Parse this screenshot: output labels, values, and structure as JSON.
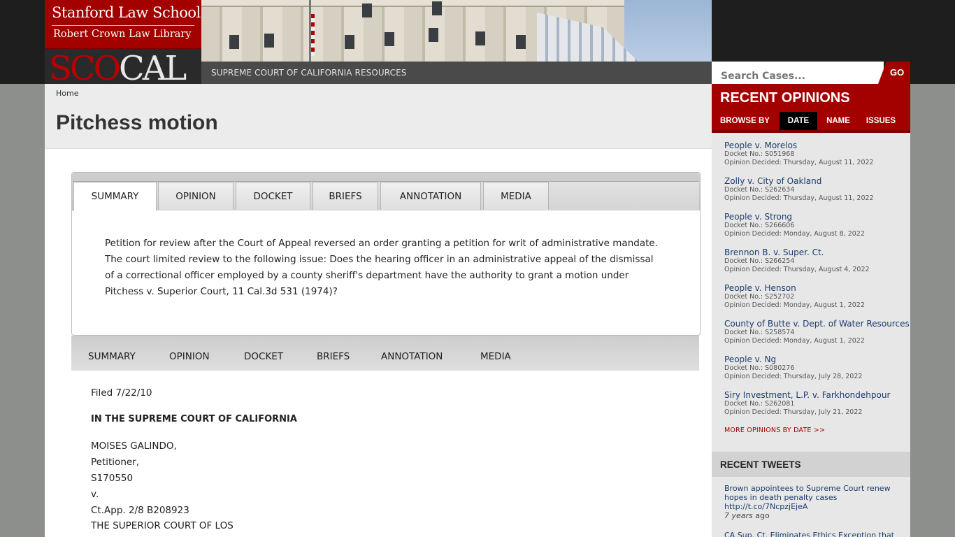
{
  "header": {
    "school": "Stanford Law School",
    "library": "Robert Crown Law Library",
    "logo_sco": "SCO",
    "logo_cal": "CAL",
    "tagline": "SUPREME COURT OF CALIFORNIA RESOURCES",
    "search_placeholder": "Search Cases...",
    "search_button": "GO"
  },
  "breadcrumb": "Home",
  "page_title": "Pitchess motion",
  "tabs": [
    "SUMMARY",
    "OPINION",
    "DOCKET",
    "BRIEFS",
    "ANNOTATION",
    "MEDIA"
  ],
  "active_tab": "SUMMARY",
  "summary_lines": [
    "Petition for review after the Court of Appeal reversed an order granting a petition for writ of administrative mandate.",
    "The court limited review to the following issue: Does the hearing officer in an administrative appeal of the dismissal",
    "of a correctional officer employed by a county sheriff's department have the authority to grant a motion under",
    "Pitchess v. Superior Court, 11 Cal.3d 531 (1974)?"
  ],
  "subnav": [
    "SUMMARY",
    "OPINION",
    "DOCKET",
    "BRIEFS",
    "ANNOTATION",
    "MEDIA"
  ],
  "document": {
    "filed": "Filed 7/22/10",
    "court": "IN THE SUPREME COURT OF CALIFORNIA",
    "lines": [
      "MOISES GALINDO,",
      "Petitioner,",
      "S170550",
      "v.",
      "Ct.App. 2/8 B208923",
      "THE SUPERIOR COURT OF LOS"
    ]
  },
  "sidebar": {
    "title": "RECENT OPINIONS",
    "browse_by": "BROWSE BY",
    "browse_tabs": [
      "DATE",
      "NAME",
      "ISSUES"
    ],
    "opinions": [
      {
        "name": "People v. Morelos",
        "docket": "Docket No.: S051968",
        "decided": "Opinion Decided: Thursday, August 11, 2022"
      },
      {
        "name": "Zolly v. City of Oakland",
        "docket": "Docket No.: S262634",
        "decided": "Opinion Decided: Thursday, August 11, 2022"
      },
      {
        "name": "People v. Strong",
        "docket": "Docket No.: S266606",
        "decided": "Opinion Decided: Monday, August 8, 2022"
      },
      {
        "name": "Brennon B. v. Super. Ct.",
        "docket": "Docket No.: S266254",
        "decided": "Opinion Decided: Thursday, August 4, 2022"
      },
      {
        "name": "People v. Henson",
        "docket": "Docket No.: S252702",
        "decided": "Opinion Decided: Monday, August 1, 2022"
      },
      {
        "name": "County of Butte v. Dept. of Water Resources",
        "docket": "Docket No.: S258574",
        "decided": "Opinion Decided: Monday, August 1, 2022"
      },
      {
        "name": "People v. Ng",
        "docket": "Docket No.: S080276",
        "decided": "Opinion Decided: Thursday, July 28, 2022"
      },
      {
        "name": "Siry Investment, L.P. v. Farkhondehpour",
        "docket": "Docket No.: S262081",
        "decided": "Opinion Decided: Thursday, July 21, 2022"
      }
    ],
    "more_link": "MORE OPINIONS BY DATE >>",
    "tweets_title": "RECENT TWEETS",
    "tweets": [
      {
        "line1": "Brown appointees to Supreme Court renew",
        "line2": "hopes in death penalty cases",
        "link": "http://t.co/7NcpzjEjeA",
        "ago_time": "7 years",
        "ago_word": "ago"
      },
      {
        "line1": "CA Sup. Ct. Eliminates Ethics Exception that"
      }
    ]
  },
  "colors": {
    "brand_red": "#a30000",
    "link_blue": "#1b3c6b",
    "header_bg": "#1e1e1e"
  }
}
